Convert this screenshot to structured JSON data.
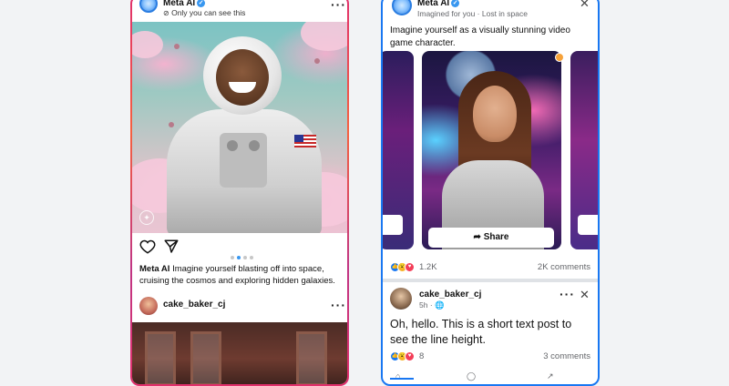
{
  "instagram": {
    "author": "Meta AI",
    "subtitle": "Only you can see this",
    "caption_author": "Meta AI",
    "caption_text": "Imagine yourself blasting off into space, cruising the cosmos and exploring hidden galaxies.",
    "carousel_total": 4,
    "carousel_active": 2,
    "next_user": "cake_baker_cj",
    "more_icon": "more-dots-icon",
    "like_icon": "heart-icon",
    "share_icon": "send-icon",
    "verified_icon": "verified-badge-icon",
    "private_icon": "eye-off-icon"
  },
  "facebook": {
    "author": "Meta AI",
    "subtitle": "Imagined for you · Lost in space",
    "post_text": "Imagine yourself as a visually stunning video game character.",
    "share_label": "Share",
    "reaction_count": "1.2K",
    "comment_count": "2K comments",
    "post2": {
      "user": "cake_baker_cj",
      "time": "5h ·",
      "text": "Oh, hello. This is a short text post to see the line height.",
      "reaction_count": "8",
      "comment_count": "3 comments"
    },
    "colors": {
      "brand_blue": "#1877f2",
      "like_blue": "#1877f2",
      "love_red": "#f33e58",
      "wow_yellow": "#f7b125"
    }
  }
}
